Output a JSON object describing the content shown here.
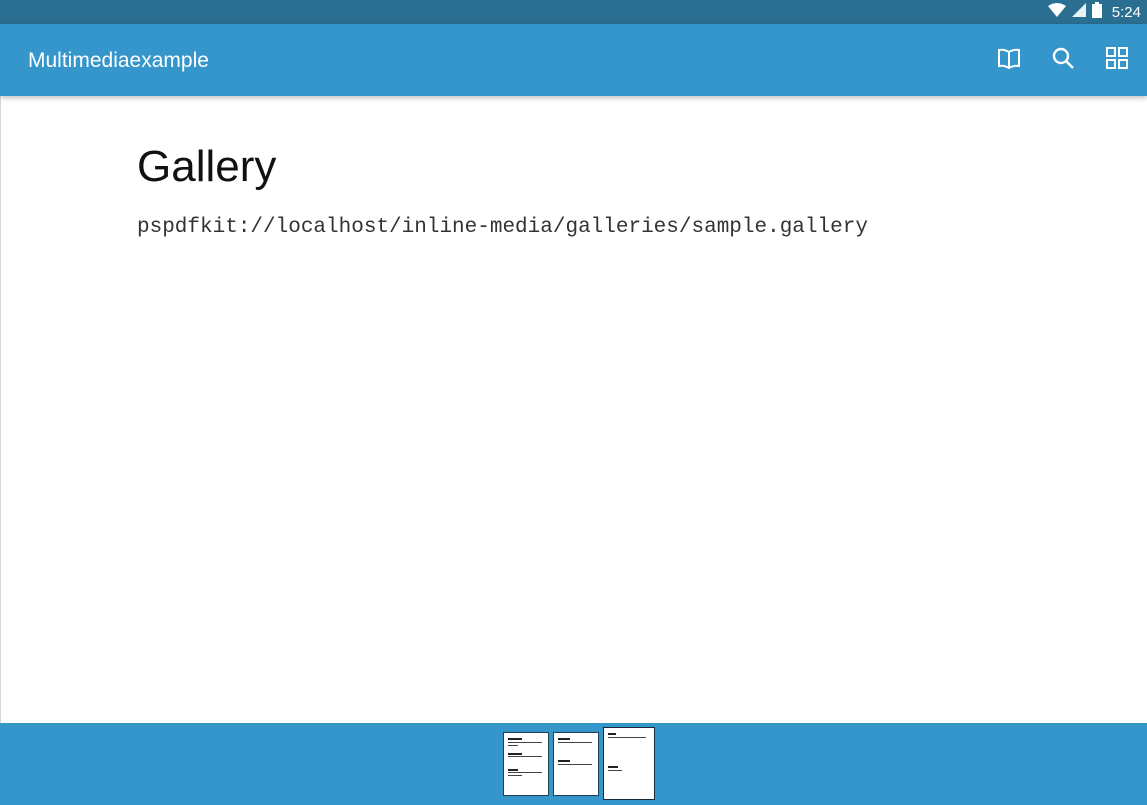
{
  "status_bar": {
    "time": "5:24",
    "icons": [
      "wifi-icon",
      "cell-signal-icon",
      "battery-icon"
    ]
  },
  "toolbar": {
    "title": "Multimediaexample",
    "actions": [
      {
        "name": "outline-book-icon"
      },
      {
        "name": "search-icon"
      },
      {
        "name": "grid-view-icon"
      }
    ]
  },
  "document": {
    "heading": "Gallery",
    "url": "pspdfkit://localhost/inline-media/galleries/sample.gallery"
  },
  "thumbnails": {
    "count": 3,
    "current_page": 3
  },
  "colors": {
    "status_bar": "#2a6f92",
    "primary": "#3496cb",
    "background": "#ffffff"
  }
}
